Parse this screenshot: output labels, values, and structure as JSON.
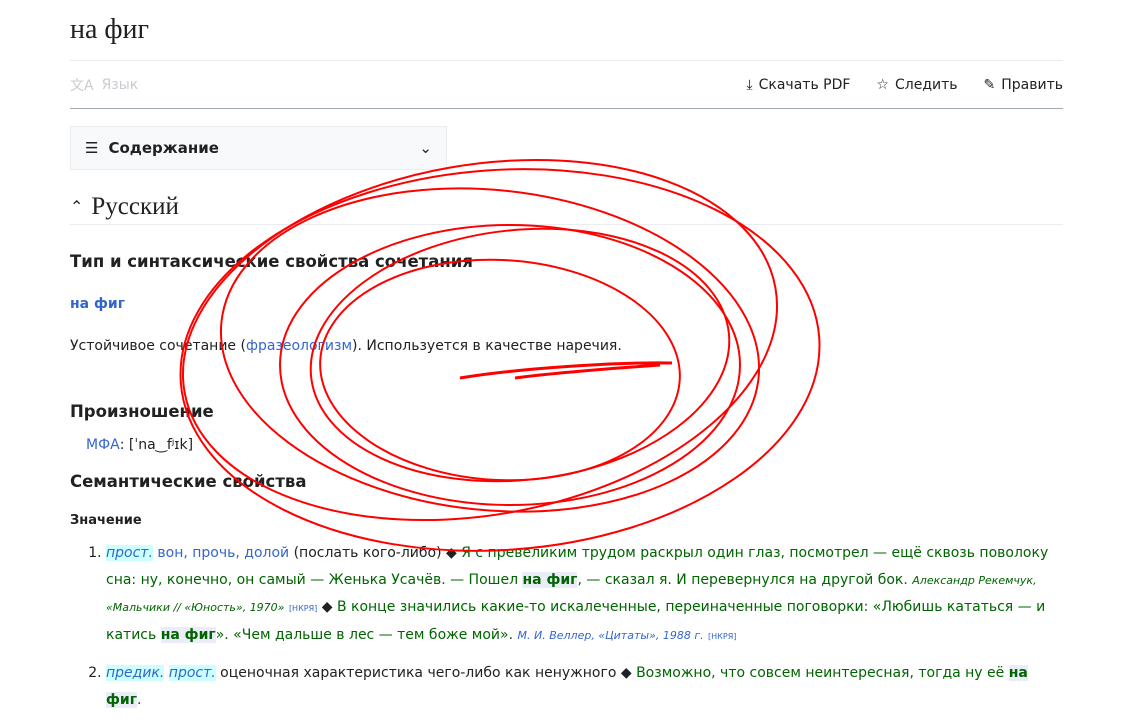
{
  "title": "на фиг",
  "toolbar": {
    "language": "Язык",
    "download_pdf": "Скачать PDF",
    "watch": "Следить",
    "edit": "Править"
  },
  "toc": {
    "label": "Содержание"
  },
  "section": {
    "title": "Русский"
  },
  "syntax": {
    "heading": "Тип и синтаксические свойства сочетания",
    "headword": "на фиг",
    "desc_before": "Устойчивое сочетание (",
    "desc_link": "фразеологизм",
    "desc_after": "). Используется в качестве наречия."
  },
  "pron": {
    "heading": "Произношение",
    "ipa_label": "МФА",
    "ipa": ": [ˈna‿fʲɪk]"
  },
  "semantic": {
    "heading": "Семантические свойства",
    "meaning_heading": "Значение"
  },
  "meanings": [
    {
      "tags": [
        "прост."
      ],
      "links": "вон, прочь, долой",
      "gloss": " (послать кого-либо) ",
      "ex1a": "Я с превеликим трудом раскрыл один глаз, посмотрел — ещё сквозь поволоку сна: ну, конечно, он самый — Женька Усачёв. — Пошел ",
      "hl": "на фиг",
      "ex1b": ", — сказал я. И перевернулся на другой бок. ",
      "src1": "Александр Рекемчук, «Мальчики // «Юность», 1970»",
      "nk": "[НКРЯ]",
      "ex2a": "В конце значились какие-то искалеченные, переиначенные поговорки: «Любишь кататься — и катись ",
      "ex2b": "». «Чем дальше в лес — тем боже мой». ",
      "src2": "М. И. Веллер, «Цитаты», 1988 г."
    },
    {
      "tags": [
        "предик.",
        "прост."
      ],
      "gloss": " оценочная характеристика чего-либо как ненужного ",
      "ex1a": "Возможно, что совсем неинтересная, тогда ну её ",
      "hl": "на фиг",
      "ex1b": "."
    }
  ],
  "colors": {
    "annotation": "#ff0000",
    "link": "#3366cc",
    "example": "#006400"
  }
}
